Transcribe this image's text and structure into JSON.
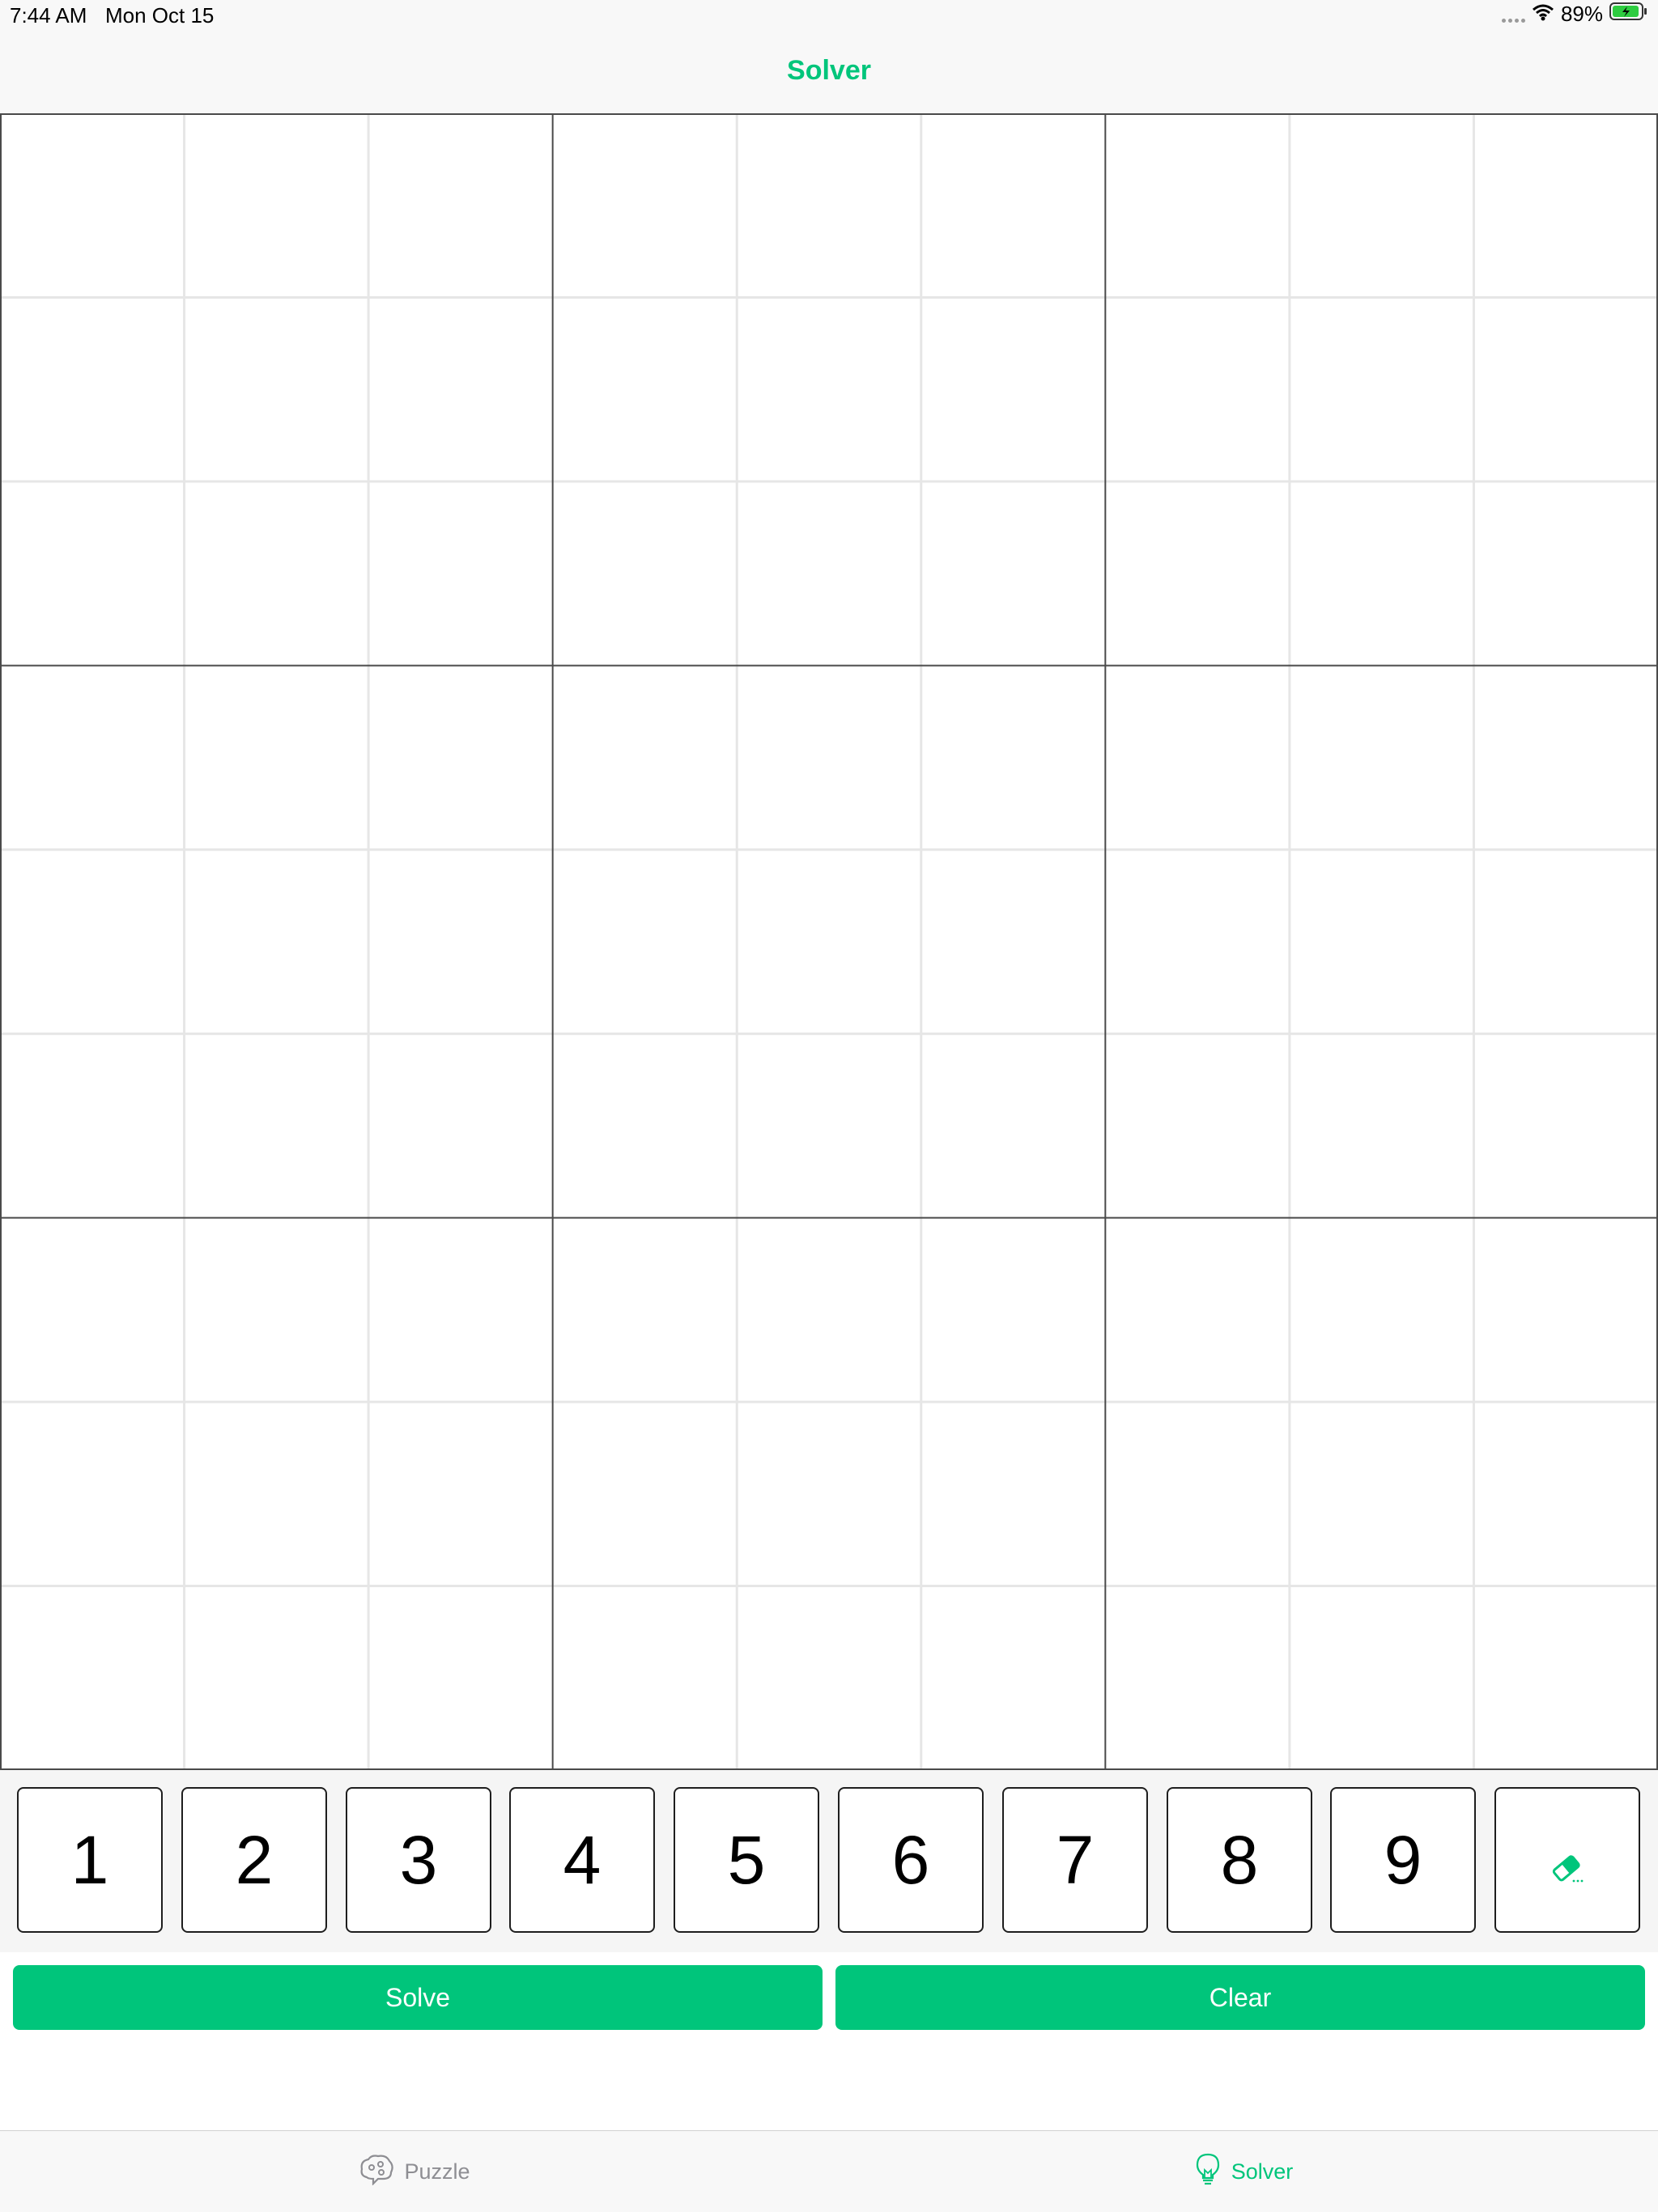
{
  "status_bar": {
    "time": "7:44 AM",
    "date": "Mon Oct 15",
    "battery": "89%"
  },
  "nav": {
    "title": "Solver"
  },
  "board": {
    "cells": [
      [
        "",
        "",
        "",
        "",
        "",
        "",
        "",
        "",
        ""
      ],
      [
        "",
        "",
        "",
        "",
        "",
        "",
        "",
        "",
        ""
      ],
      [
        "",
        "",
        "",
        "",
        "",
        "",
        "",
        "",
        ""
      ],
      [
        "",
        "",
        "",
        "",
        "",
        "",
        "",
        "",
        ""
      ],
      [
        "",
        "",
        "",
        "",
        "",
        "",
        "",
        "",
        ""
      ],
      [
        "",
        "",
        "",
        "",
        "",
        "",
        "",
        "",
        ""
      ],
      [
        "",
        "",
        "",
        "",
        "",
        "",
        "",
        "",
        ""
      ],
      [
        "",
        "",
        "",
        "",
        "",
        "",
        "",
        "",
        ""
      ],
      [
        "",
        "",
        "",
        "",
        "",
        "",
        "",
        "",
        ""
      ]
    ]
  },
  "keypad": {
    "keys": [
      "1",
      "2",
      "3",
      "4",
      "5",
      "6",
      "7",
      "8",
      "9"
    ],
    "erase_icon": "eraser-icon"
  },
  "actions": {
    "solve_label": "Solve",
    "clear_label": "Clear"
  },
  "tabbar": {
    "items": [
      {
        "label": "Puzzle",
        "icon": "brain-icon"
      },
      {
        "label": "Solver",
        "icon": "lightbulb-icon"
      }
    ]
  },
  "colors": {
    "accent": "#00c57b",
    "inactive": "#8e8e93",
    "thick_line": "#4a4a4a",
    "thin_line": "#e6e6e6"
  }
}
